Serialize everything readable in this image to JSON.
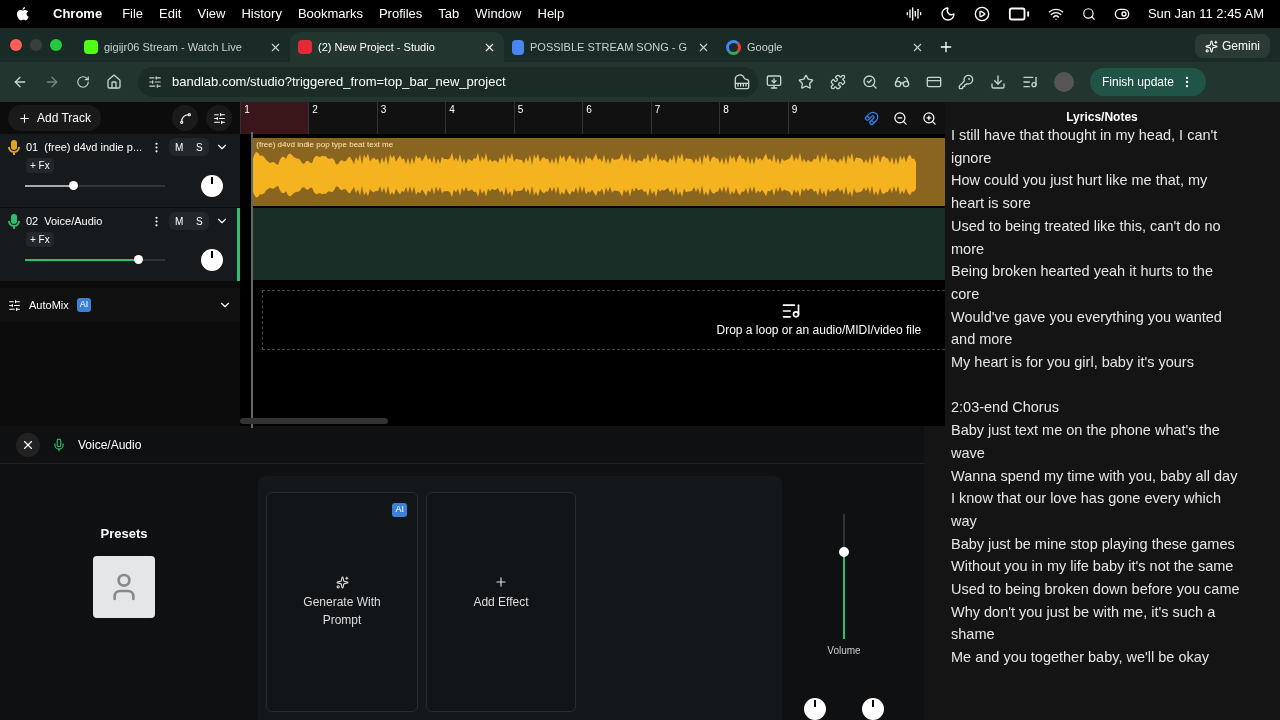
{
  "menubar": {
    "app": "Chrome",
    "menus": [
      "File",
      "Edit",
      "View",
      "History",
      "Bookmarks",
      "Profiles",
      "Tab",
      "Window",
      "Help"
    ],
    "clock": "Sun Jan 11  2:45 AM"
  },
  "tabs": [
    {
      "title": "gigijr06 Stream - Watch Live",
      "selected": false
    },
    {
      "title": "(2) New Project - Studio",
      "selected": true
    },
    {
      "title": "POSSIBLE STREAM SONG - G",
      "selected": false
    },
    {
      "title": "Google",
      "selected": false
    }
  ],
  "gemini": "Gemini",
  "address": "bandlab.com/studio?triggered_from=top_bar_new_project",
  "finish_update": "Finish update",
  "studio": {
    "add_track": "Add Track",
    "tracks": [
      {
        "number": "01",
        "name": "(free) d4vd  indie p...",
        "fx": "+ Fx",
        "mute": "M",
        "solo": "S",
        "level": 0.34,
        "color": "#e0a526",
        "selected": false
      },
      {
        "number": "02",
        "name": "Voice/Audio",
        "fx": "+ Fx",
        "mute": "M",
        "solo": "S",
        "level": 0.81,
        "color": "#2fbf71",
        "selected": true
      }
    ],
    "automix": {
      "label": "AutoMix",
      "badge": "AI"
    },
    "ruler": [
      "1",
      "2",
      "3",
      "4",
      "5",
      "6",
      "7",
      "8",
      "9"
    ],
    "clip_title": "(free) d4vd  indie pop type beat text me",
    "drop_hint": "Drop a loop or an audio/MIDI/video file"
  },
  "lyrics": {
    "title": "Lyrics/Notes",
    "stanzas": [
      [
        "I still have that thought in my head, I can't ignore",
        "How could you just hurt like me that, my heart is sore",
        "Used to being treated like this, can't do no more",
        "Being broken hearted yeah it hurts to the core",
        "Would've gave you everything you wanted and more",
        "My heart is for you girl, baby it's yours"
      ],
      [
        "2:03-end Chorus",
        "Baby just text me on the phone what's the wave",
        "Wanna spend my time with you, baby all day",
        "I know that our love has gone every which way",
        "Baby just be mine stop playing these games",
        "Without you in my life baby it's not the same",
        "Used to being broken down before you came",
        "Why don't you just be with me, it's such a shame",
        "Me and you together baby, we'll be okay"
      ]
    ]
  },
  "bottom": {
    "track": "Voice/Audio",
    "presets": "Presets",
    "generate": "Generate With Prompt",
    "generate_badge": "AI",
    "add_effect": "Add Effect",
    "volume": {
      "label": "Volume",
      "level": 0.7
    }
  }
}
